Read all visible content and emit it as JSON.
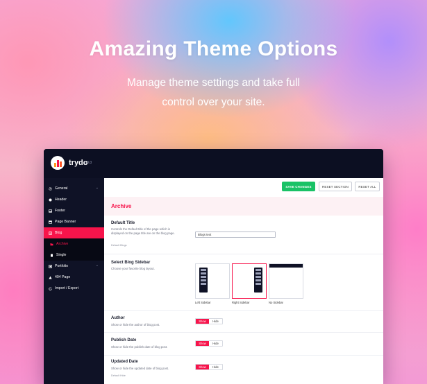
{
  "hero": {
    "title": "Amazing Theme Options",
    "subtitle_line1": "Manage theme settings and take full",
    "subtitle_line2": "control over your site."
  },
  "app": {
    "logo_text": "trydo",
    "version": "1.0.0"
  },
  "sidebar": {
    "items": [
      {
        "label": "General",
        "icon": "gear-icon",
        "has_chevron": true
      },
      {
        "label": "Header",
        "icon": "header-icon"
      },
      {
        "label": "Footer",
        "icon": "footer-icon"
      },
      {
        "label": "Page Banner",
        "icon": "banner-icon"
      },
      {
        "label": "Blog",
        "icon": "blog-icon",
        "active": true
      },
      {
        "label": "Portfolio",
        "icon": "portfolio-icon",
        "has_chevron": true
      },
      {
        "label": "404 Page",
        "icon": "warning-icon"
      },
      {
        "label": "Import / Export",
        "icon": "refresh-icon"
      }
    ],
    "blog_sub": [
      {
        "label": "Archive",
        "active": true
      },
      {
        "label": "Single"
      }
    ],
    "chevron": "⌄"
  },
  "toolbar": {
    "save_label": "SAVE CHANGES",
    "reset_section_label": "RESET SECTION",
    "reset_all_label": "RESET ALL"
  },
  "section": {
    "title": "Archive"
  },
  "fields": {
    "default_title": {
      "title": "Default Title",
      "desc": "Controls the Default title of the page which is displayed on the page title are on the blog page.",
      "note": "Default Blogs",
      "value": "Blogs text"
    },
    "blog_sidebar": {
      "title": "Select Blog Sidebar",
      "desc": "Choose your favorite blog layout.",
      "options": [
        "Left Sidebar",
        "Right Sidebar",
        "No Sidebar"
      ],
      "selected": "Right Sidebar"
    },
    "author": {
      "title": "Author",
      "desc": "Show or hide the author of blog post.",
      "on": "Show",
      "off": "Hide"
    },
    "publish_date": {
      "title": "Publish Date",
      "desc": "Show or hide the publish date of blog post.",
      "on": "Show",
      "off": "Hide"
    },
    "updated_date": {
      "title": "Updated Date",
      "desc": "Show or hide the updated date of blog post.",
      "note": "Default Hide",
      "on": "Show",
      "off": "Hide"
    }
  },
  "colors": {
    "accent": "#f7144b",
    "save": "#19c266",
    "dark": "#0f1226"
  }
}
